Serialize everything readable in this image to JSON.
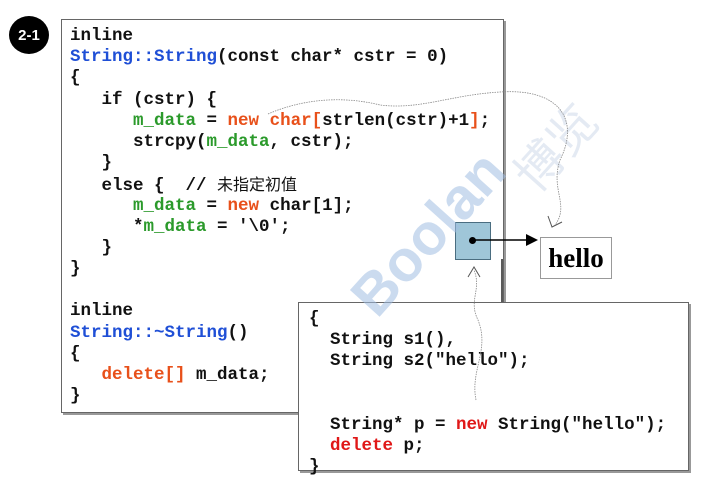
{
  "badge": "2-1",
  "left_code": [
    [
      [
        "inline",
        ""
      ]
    ],
    [
      [
        "String::String",
        "blue"
      ],
      [
        "(const char* cstr = 0)",
        ""
      ]
    ],
    [
      [
        "{",
        ""
      ]
    ],
    [
      [
        "   if (cstr) {",
        ""
      ]
    ],
    [
      [
        "      ",
        ""
      ],
      [
        "m_data",
        "green"
      ],
      [
        " = ",
        ""
      ],
      [
        "new",
        "orange"
      ],
      [
        " ",
        ""
      ],
      [
        "char[",
        "orange"
      ],
      [
        "strlen(cstr)+1",
        ""
      ],
      [
        "]",
        "orange"
      ],
      [
        ";",
        ""
      ]
    ],
    [
      [
        "      strcpy(",
        ""
      ],
      [
        "m_data",
        "green"
      ],
      [
        ", cstr);",
        ""
      ]
    ],
    [
      [
        "   }",
        ""
      ]
    ],
    [
      [
        "   else {  // ",
        ""
      ],
      [
        "未指定初值",
        "cjk"
      ]
    ],
    [
      [
        "      ",
        ""
      ],
      [
        "m_data",
        "green"
      ],
      [
        " = ",
        ""
      ],
      [
        "new",
        "orange"
      ],
      [
        " char[1];",
        ""
      ]
    ],
    [
      [
        "      *",
        ""
      ],
      [
        "m_data",
        "green"
      ],
      [
        " = '\\0';",
        ""
      ]
    ],
    [
      [
        "   }",
        ""
      ]
    ],
    [
      [
        "}",
        ""
      ]
    ],
    [
      [
        "",
        ""
      ]
    ],
    [
      [
        "inline",
        ""
      ]
    ],
    [
      [
        "String::~String",
        "blue"
      ],
      [
        "()",
        ""
      ]
    ],
    [
      [
        "{",
        ""
      ]
    ],
    [
      [
        "   ",
        ""
      ],
      [
        "delete[]",
        "orange"
      ],
      [
        " m_data;",
        ""
      ]
    ],
    [
      [
        "}",
        ""
      ]
    ]
  ],
  "right_code": [
    [
      [
        "{",
        ""
      ]
    ],
    [
      [
        "  String s1(),",
        ""
      ]
    ],
    [
      [
        "  String s2(\"hello\");",
        ""
      ]
    ],
    [
      [
        "",
        ""
      ]
    ],
    [
      [
        "",
        ""
      ]
    ],
    [
      [
        "  String* p = ",
        ""
      ],
      [
        "new",
        "red"
      ],
      [
        " String(\"hello\");",
        ""
      ]
    ],
    [
      [
        "  ",
        ""
      ],
      [
        "delete",
        "red"
      ],
      [
        " p;",
        ""
      ]
    ],
    [
      [
        "}",
        ""
      ]
    ]
  ],
  "heap_value": "hello",
  "watermark": {
    "text": "Boolan",
    "cjk": "博览"
  },
  "colors": {
    "type": "#1f4fd6",
    "member": "#2b9a2b",
    "keyword": "#e8501a",
    "keyword2": "#e01818",
    "pointer_cell": "#9fc6d8"
  }
}
